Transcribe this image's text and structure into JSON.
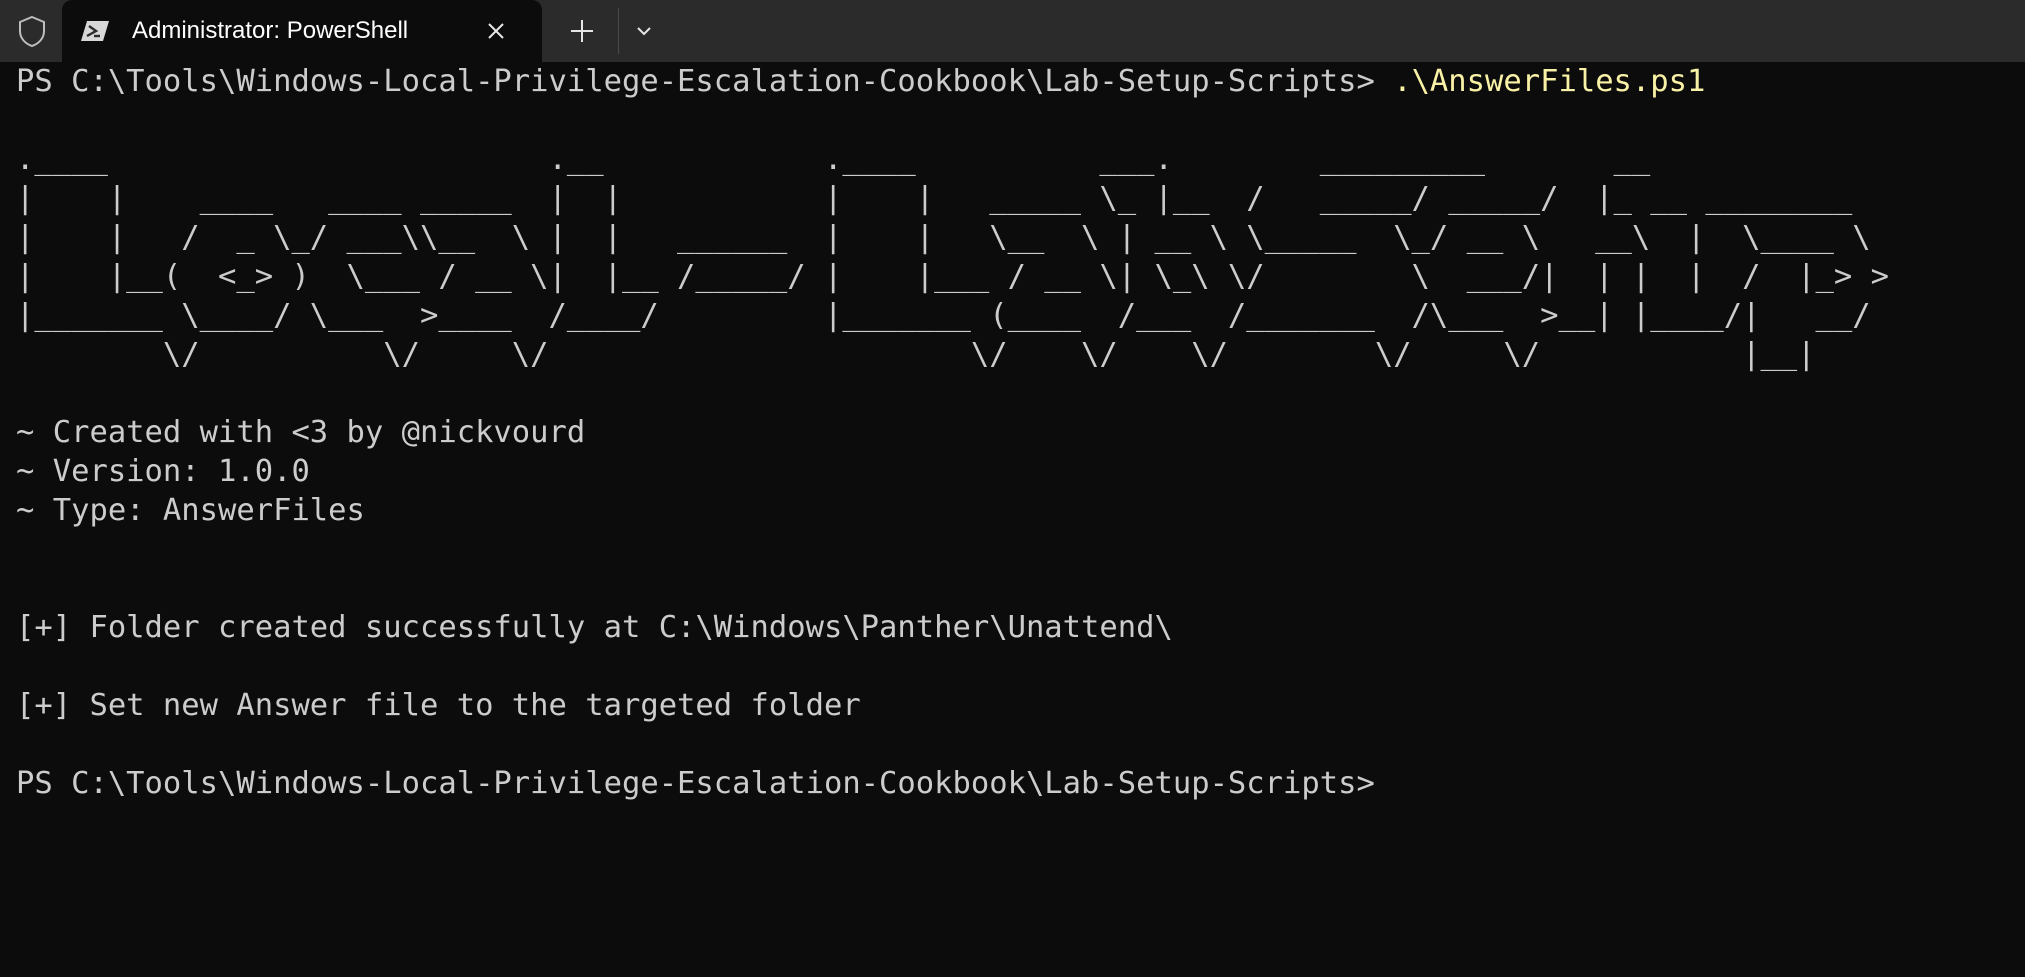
{
  "tab": {
    "title": "Administrator: PowerShell",
    "icon": "powershell-icon",
    "close_icon": "close-icon",
    "new_tab_icon": "plus-icon",
    "dropdown_icon": "chevron-down-icon",
    "shield_icon": "shield-icon"
  },
  "colors": {
    "titlebar": "#2b2b2b",
    "background": "#0c0c0c",
    "text": "#cccccc",
    "command": "#f9f1a5"
  },
  "terminal": {
    "prompt": "PS C:\\Tools\\Windows-Local-Privilege-Escalation-Cookbook\\Lab-Setup-Scripts> ",
    "command": ".\\AnswerFiles.ps1",
    "banner": [
      ".____                        .__            .____          ___.        _________       __",
      "|    |    ____   ____ _____  |  |           |    |   _____ \\_ |__  /   _____/ _____/  |_ __ ________",
      "|    |   /  _ \\_/ ___\\\\__  \\ |  |   ______  |    |   \\__  \\ | __ \\ \\_____  \\_/ __ \\   __\\  |  \\____ \\",
      "|    |__(  <_> )  \\___ / __ \\|  |__ /_____/ |    |___ / __ \\| \\_\\ \\/        \\  ___/|  | |  |  /  |_> >",
      "|_______ \\____/ \\___  >____  /____/         |_______ (____  /___  /_______  /\\___  >__| |____/|   __/",
      "        \\/          \\/     \\/                       \\/    \\/    \\/        \\/     \\/           |__|"
    ],
    "info": [
      "~ Created with <3 by @nickvourd",
      "~ Version: 1.0.0",
      "~ Type: AnswerFiles"
    ],
    "messages": [
      "[+] Folder created successfully at C:\\Windows\\Panther\\Unattend\\",
      "[+] Set new Answer file to the targeted folder"
    ],
    "final_prompt": "PS C:\\Tools\\Windows-Local-Privilege-Escalation-Cookbook\\Lab-Setup-Scripts>"
  }
}
